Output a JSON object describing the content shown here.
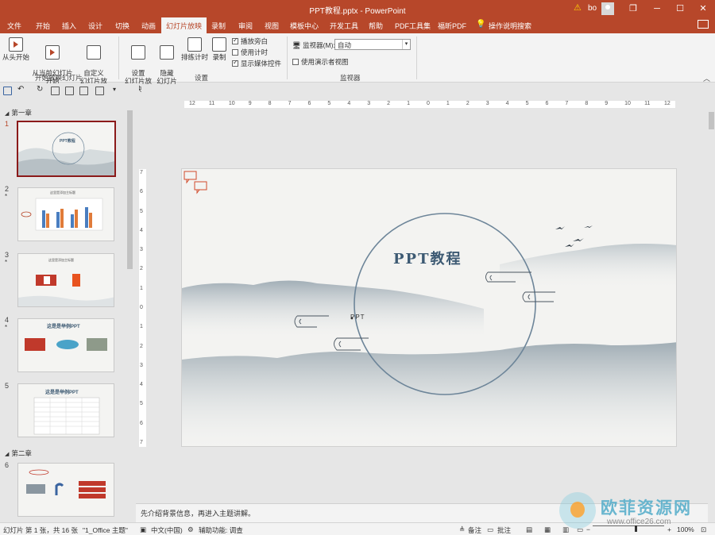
{
  "titlebar": {
    "title": "PPT教程.pptx  -  PowerPoint",
    "user": "bo",
    "minimize": "─",
    "restore": "❐",
    "maximize": "☐",
    "close": "✕"
  },
  "tabs": [
    {
      "label": "文件"
    },
    {
      "label": "开始"
    },
    {
      "label": "插入"
    },
    {
      "label": "设计"
    },
    {
      "label": "切换"
    },
    {
      "label": "动画"
    },
    {
      "label": "幻灯片放映",
      "active": true
    },
    {
      "label": "录制"
    },
    {
      "label": "审阅"
    },
    {
      "label": "视图"
    },
    {
      "label": "模板中心"
    },
    {
      "label": "开发工具"
    },
    {
      "label": "帮助"
    },
    {
      "label": "PDF工具集"
    },
    {
      "label": "福昕PDF"
    },
    {
      "label": "操作说明搜索"
    }
  ],
  "ribbon": {
    "from_beginning": "从头开始",
    "from_current": "从当前幻灯片\n开始",
    "custom_show": "自定义\n幻灯片放映",
    "group_start": "开始放映幻灯片",
    "setup_show": "设置\n幻灯片放映",
    "hide_slide": "隐藏\n幻灯片",
    "rehearse": "排练计时",
    "record": "录制",
    "play_narrations": "播放旁白",
    "use_timings": "使用计时",
    "show_media_controls": "显示媒体控件",
    "group_setup": "设置",
    "monitor_label": "监视器(M):",
    "monitor_value": "自动",
    "presenter_view": "使用演示者视图",
    "group_monitors": "监视器"
  },
  "sections": [
    "第一章",
    "第二章"
  ],
  "slides": [
    {
      "num": "1",
      "title": "PPT教程"
    },
    {
      "num": "2",
      "star": "*",
      "title": "这里是添加主标题"
    },
    {
      "num": "3",
      "star": "*",
      "title": "这里是添加主标题"
    },
    {
      "num": "4",
      "star": "*",
      "title": "这是是举例PPT"
    },
    {
      "num": "5",
      "title": "这是是举例PPT"
    },
    {
      "num": "6"
    }
  ],
  "ruler": {
    "h_ticks": [
      "12",
      "11",
      "10",
      "9",
      "8",
      "7",
      "6",
      "5",
      "4",
      "3",
      "2",
      "1",
      "0",
      "1",
      "2",
      "3",
      "4",
      "5",
      "6",
      "7",
      "8",
      "9",
      "10",
      "11",
      "12"
    ],
    "v_ticks": [
      "7",
      "6",
      "5",
      "4",
      "3",
      "2",
      "1",
      "0",
      "1",
      "2",
      "3",
      "4",
      "5",
      "6",
      "7"
    ]
  },
  "slide": {
    "title": "PPT教程",
    "subtitle": "PPT"
  },
  "notes": "先介绍背景信息，再进入主题讲解。",
  "status": {
    "slide_info": "幻灯片 第 1 张，共 16 张",
    "theme": "\"1_Office 主题\"",
    "language": "中文(中国)",
    "accessibility": "辅助功能: 调查",
    "notes_btn": "备注",
    "comments_btn": "批注",
    "zoom": "100%"
  },
  "watermark": {
    "cn": "欧菲资源网",
    "url": "www.office26.com"
  },
  "colors": {
    "accent": "#b7472a",
    "ink": "#3d5a73"
  }
}
